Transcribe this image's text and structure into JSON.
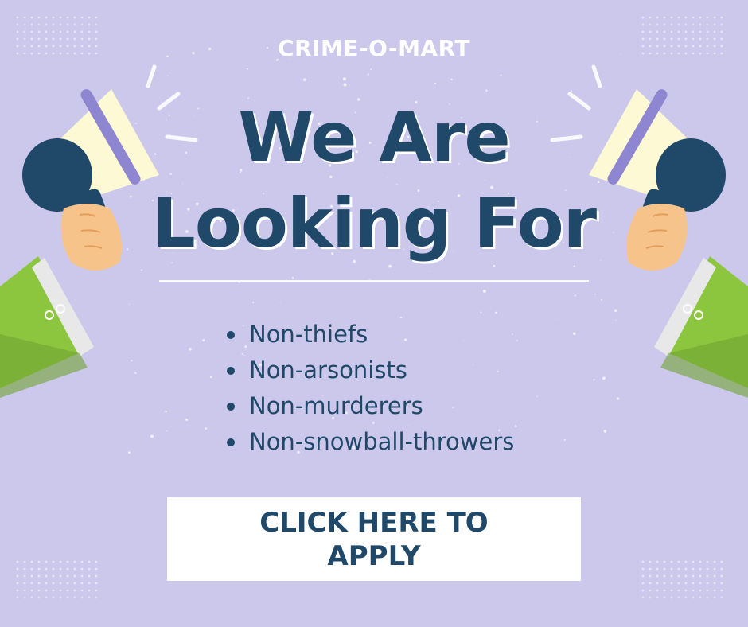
{
  "brand": "CRIME-O-MART",
  "headline": {
    "line1": "We Are",
    "line2": "Looking For"
  },
  "list": [
    "Non-thiefs",
    "Non-arsonists",
    "Non-murderers",
    "Non-snowball-throwers"
  ],
  "cta": {
    "label": "CLICK HERE TO APPLY"
  },
  "colors": {
    "background": "#cbc8ec",
    "text_primary": "#204868",
    "white": "#ffffff",
    "sleeve": "#8cc63f",
    "megaphone_cone": "#fcf9d4",
    "megaphone_rim": "#8e86d0",
    "skin": "#f6c48b"
  },
  "icons": [
    "megaphone-icon-left",
    "megaphone-icon-right",
    "hand-icon-left",
    "hand-icon-right"
  ]
}
